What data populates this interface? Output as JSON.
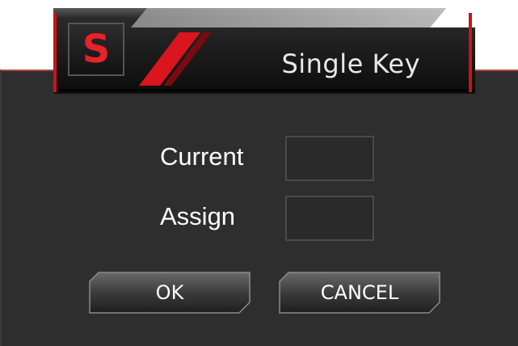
{
  "dialog": {
    "logo_letter": "S",
    "title": "Single Key"
  },
  "form": {
    "current_label": "Current",
    "current_value": "",
    "assign_label": "Assign",
    "assign_value": ""
  },
  "buttons": {
    "ok_label": "OK",
    "cancel_label": "CANCEL"
  },
  "colors": {
    "accent": "#e4232b",
    "panel": "#2e2e2e",
    "text": "#ffffff"
  },
  "icons": {
    "logo": "brand-s-logo-icon"
  }
}
